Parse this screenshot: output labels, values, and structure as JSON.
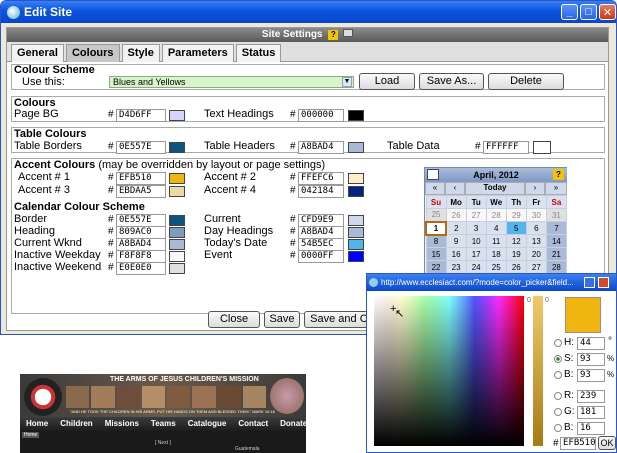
{
  "window": {
    "title": "Edit Site"
  },
  "settings_bar": {
    "title": "Site Settings"
  },
  "tabs": [
    "General",
    "Colours",
    "Style",
    "Parameters",
    "Status"
  ],
  "colour_scheme": {
    "heading": "Colour Scheme",
    "use_label": "Use this:",
    "selected": "Blues and Yellows",
    "load": "Load",
    "save_as": "Save As...",
    "delete": "Delete"
  },
  "colours": {
    "heading": "Colours",
    "page_bg": {
      "label": "Page BG",
      "hex": "D4D6FF",
      "color": "#D4D6FF"
    },
    "text_headings": {
      "label": "Text Headings",
      "hex": "000000",
      "color": "#000000"
    }
  },
  "table_colours": {
    "heading": "Table Colours",
    "borders": {
      "label": "Table Borders",
      "hex": "0E557E",
      "color": "#0E557E"
    },
    "headers": {
      "label": "Table Headers",
      "hex": "A8BAD4",
      "color": "#A8BAD4"
    },
    "data": {
      "label": "Table Data",
      "hex": "FFFFFF",
      "color": "#FFFFFF"
    }
  },
  "accent_colours": {
    "heading": "Accent Colours",
    "note": "(may be overridden by layout or page settings)",
    "a1": {
      "label": "Accent # 1",
      "hex": "EFB510",
      "color": "#EFB510"
    },
    "a2": {
      "label": "Accent # 2",
      "hex": "FFEFC6",
      "color": "#FFEFC6"
    },
    "a3": {
      "label": "Accent # 3",
      "hex": "EBDAA5",
      "color": "#EBDAA5"
    },
    "a4": {
      "label": "Accent # 4",
      "hex": "042184",
      "color": "#042184"
    }
  },
  "calendar_scheme": {
    "heading": "Calendar Colour Scheme",
    "border": {
      "label": "Border",
      "hex": "0E557E",
      "color": "#0E557E"
    },
    "heading_row": {
      "label": "Heading",
      "hex": "809AC0",
      "color": "#809AC0"
    },
    "current_wknd": {
      "label": "Current Wknd",
      "hex": "A8BAD4",
      "color": "#A8BAD4"
    },
    "inactive_weekday": {
      "label": "Inactive Weekday",
      "hex": "F8F8F8",
      "color": "#F8F8F8"
    },
    "inactive_weekend": {
      "label": "Inactive Weekend",
      "hex": "E0E0E0",
      "color": "#E0E0E0"
    },
    "current": {
      "label": "Current",
      "hex": "CFD9E9",
      "color": "#CFD9E9"
    },
    "day_headings": {
      "label": "Day Headings",
      "hex": "A8BAD4",
      "color": "#A8BAD4"
    },
    "todays_date": {
      "label": "Today's Date",
      "hex": "54B5EC",
      "color": "#54B5EC"
    },
    "event": {
      "label": "Event",
      "hex": "0000FF",
      "color": "#0000FF"
    }
  },
  "calendar": {
    "month": "April, 2012",
    "help": "?",
    "nav": [
      "«",
      "‹",
      "Today",
      "›",
      "»"
    ],
    "days": [
      "Su",
      "Mo",
      "Tu",
      "We",
      "Th",
      "Fr",
      "Sa"
    ],
    "rows": [
      [
        "25",
        "26",
        "27",
        "28",
        "29",
        "30",
        "31"
      ],
      [
        "1",
        "2",
        "3",
        "4",
        "5",
        "6",
        "7"
      ],
      [
        "8",
        "9",
        "10",
        "11",
        "12",
        "13",
        "14"
      ],
      [
        "15",
        "16",
        "17",
        "18",
        "19",
        "20",
        "21"
      ],
      [
        "22",
        "23",
        "24",
        "25",
        "26",
        "27",
        "28"
      ]
    ]
  },
  "footer": {
    "close": "Close",
    "save": "Save",
    "save_close": "Save and Close"
  },
  "website": {
    "banner": "THE ARMS OF JESUS CHILDREN'S MISSION",
    "quote": "\"AND HE TOOK THE CHILDREN IN HIS ARMS, PUT HIS HANDS ON THEM AND BLESSED THEM.\" MARK 10:16",
    "nav": [
      "Home",
      "Children",
      "Missions",
      "Teams",
      "Catalogue",
      "Contact",
      "Donate"
    ],
    "crumb": "Home",
    "next": "[ Next ]",
    "side": "Guatemala"
  },
  "picker": {
    "title": "http://www.ecclesiact.com/?mode=color_picker&field...",
    "scale_left": "0",
    "scale_right": "0",
    "H": {
      "label": "H:",
      "value": "44",
      "unit": "°"
    },
    "S": {
      "label": "S:",
      "value": "93",
      "unit": "%"
    },
    "B": {
      "label": "B:",
      "value": "93",
      "unit": "%"
    },
    "R": {
      "label": "R:",
      "value": "239"
    },
    "G": {
      "label": "G:",
      "value": "181"
    },
    "Bl": {
      "label": "B:",
      "value": "16"
    },
    "hash": "#",
    "hex": "EFB510",
    "ok": "OK",
    "preview_color": "#EFB510"
  }
}
